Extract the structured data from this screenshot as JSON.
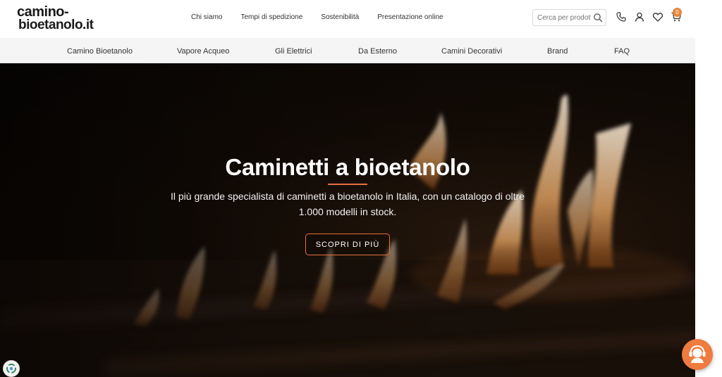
{
  "header": {
    "logo_line1": "camino-",
    "logo_line2": "bioetanolo.it",
    "top_links": [
      "Chi siamo",
      "Tempi di spedizione",
      "Sostenibilità",
      "Presentazione online"
    ],
    "search_placeholder": "Cerca per prodotto",
    "cart_count": "0",
    "icons": [
      "phone-icon",
      "user-icon",
      "heart-icon",
      "cart-icon"
    ]
  },
  "category_nav": [
    "Camino Bioetanolo",
    "Vapore Acqueo",
    "Gli Elettrici",
    "Da Esterno",
    "Camini Decorativi",
    "Brand",
    "FAQ"
  ],
  "hero": {
    "title": "Caminetti a bioetanolo",
    "subtitle": "Il più grande specialista di caminetti a bioetanolo in Italia, con un catalogo di oltre 1.000 modelli in stock.",
    "button": "SCOPRI DI PIÙ"
  },
  "colors": {
    "accent": "#e8703a",
    "nav_bg": "#f5f5f5",
    "chat_button": "#ee7b3f"
  }
}
